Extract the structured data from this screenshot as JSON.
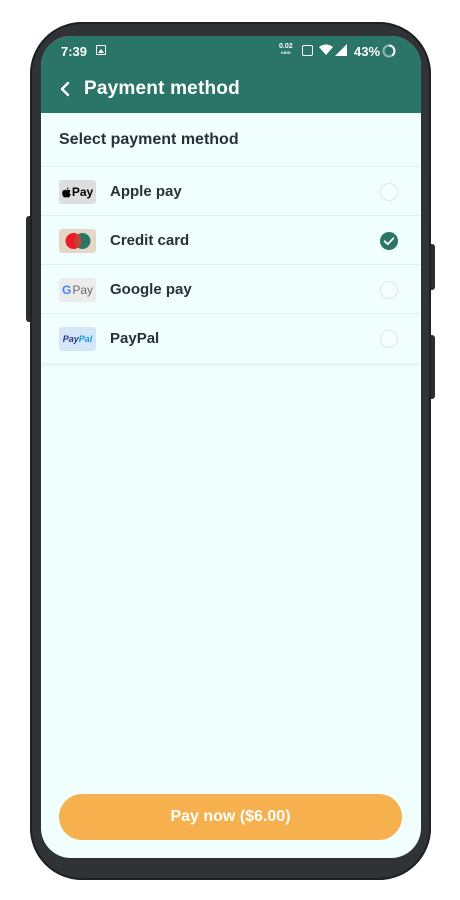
{
  "status_bar": {
    "time": "7:39",
    "speed_value": "0.02",
    "speed_unit": "KB/S",
    "battery": "43%",
    "icons": [
      "image-icon",
      "vibrate-icon",
      "wifi-icon",
      "signal-icon",
      "battery-icon"
    ]
  },
  "header": {
    "title": "Payment method",
    "background_color": "#2b7568",
    "back_icon": "chevron-left-icon"
  },
  "section_title": "Select payment method",
  "methods": [
    {
      "label": "Apple pay",
      "logo_text": "Pay",
      "logo": "apple-pay-logo",
      "selected": false
    },
    {
      "label": "Credit card",
      "logo": "mastercard-logo",
      "selected": true
    },
    {
      "label": "Google pay",
      "logo_text": "Pay",
      "logo_letter": "G",
      "logo": "google-pay-logo",
      "selected": false
    },
    {
      "label": "PayPal",
      "logo_text_1": "Pay",
      "logo_text_2": "Pal",
      "logo": "paypal-logo",
      "selected": false
    }
  ],
  "pay_button": {
    "label": "Pay now ($6.00)",
    "color": "#f6b14e"
  },
  "colors": {
    "primary": "#2b7568",
    "background": "#f0fffd",
    "accent": "#f6b14e"
  }
}
